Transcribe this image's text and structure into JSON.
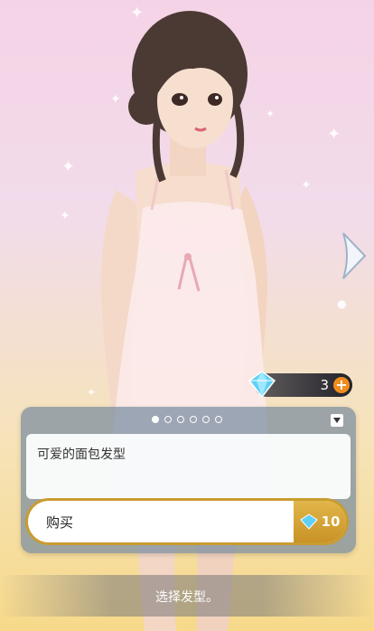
{
  "wallet": {
    "diamonds": "3"
  },
  "pager": {
    "total": 6,
    "active": 0
  },
  "item": {
    "description": "可爱的面包发型"
  },
  "buy": {
    "label": "购买",
    "price": "10"
  },
  "caption": "选择发型。",
  "colors": {
    "accent": "#c99c2f",
    "plus": "#f08c1e",
    "panel": "#7f91a4"
  },
  "icons": [
    "diamond-icon",
    "plus-icon",
    "dropdown-icon",
    "next-arrow-icon"
  ]
}
